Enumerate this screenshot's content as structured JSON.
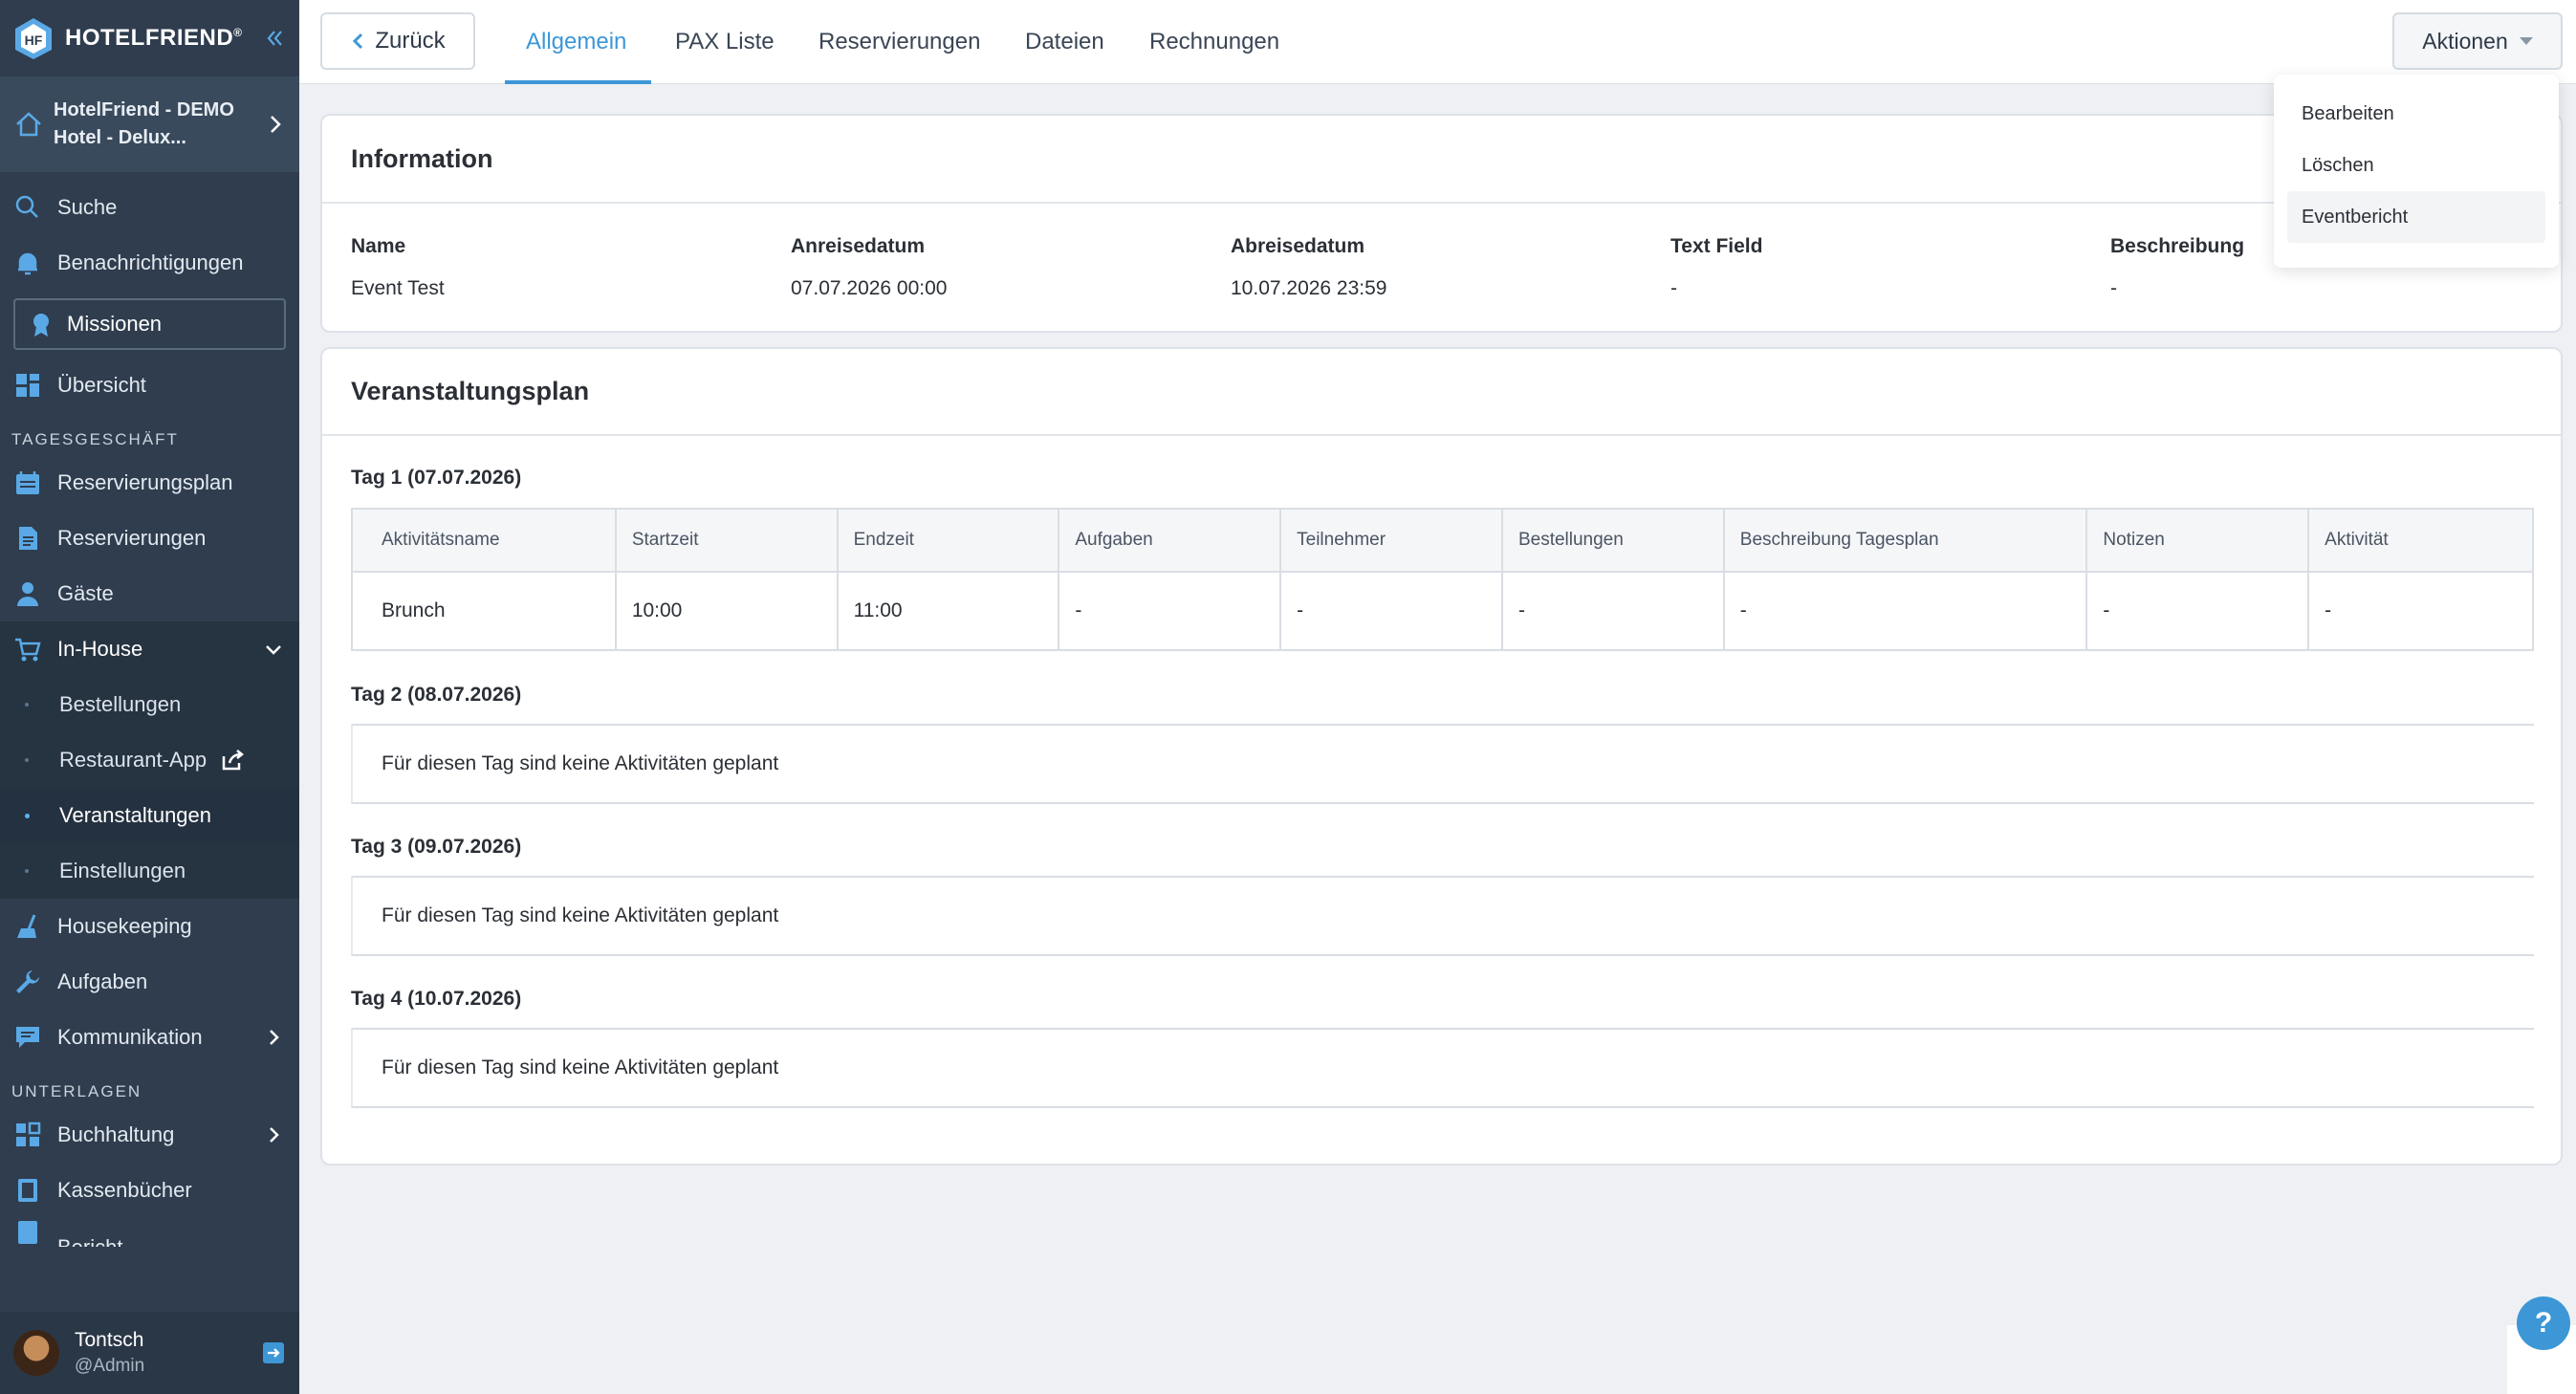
{
  "brand": {
    "name": "HOTELFRIEND",
    "mark": "®"
  },
  "hotel": {
    "name": "HotelFriend - DEMO Hotel - Delux..."
  },
  "sidebar": {
    "search": "Suche",
    "notifications": "Benachrichtigungen",
    "missions": "Missionen",
    "overview": "Übersicht",
    "section_daily": "TAGESGESCHÄFT",
    "reservation_plan": "Reservierungsplan",
    "reservations": "Reservierungen",
    "guests": "Gäste",
    "inhouse": "In-House",
    "inhouse_items": [
      "Bestellungen",
      "Restaurant-App",
      "Veranstaltungen",
      "Einstellungen"
    ],
    "housekeeping": "Housekeeping",
    "tasks": "Aufgaben",
    "communication": "Kommunikation",
    "section_docs": "UNTERLAGEN",
    "accounting": "Buchhaltung",
    "cashbooks": "Kassenbücher",
    "cut_item": "Bericht"
  },
  "user": {
    "name": "Tontsch",
    "handle": "@Admin"
  },
  "topbar": {
    "back": "Zurück",
    "tabs": [
      "Allgemein",
      "PAX Liste",
      "Reservierungen",
      "Dateien",
      "Rechnungen"
    ],
    "actions": "Aktionen"
  },
  "dropdown": {
    "items": [
      "Bearbeiten",
      "Löschen",
      "Eventbericht"
    ]
  },
  "information": {
    "title": "Information",
    "fields": [
      {
        "label": "Name",
        "value": "Event Test"
      },
      {
        "label": "Anreisedatum",
        "value": "07.07.2026 00:00"
      },
      {
        "label": "Abreisedatum",
        "value": "10.07.2026 23:59"
      },
      {
        "label": "Text Field",
        "value": "-"
      },
      {
        "label": "Beschreibung",
        "value": "-"
      }
    ]
  },
  "schedule": {
    "title": "Veranstaltungsplan",
    "day1": "Tag 1 (07.07.2026)",
    "columns": [
      "Aktivitätsname",
      "Startzeit",
      "Endzeit",
      "Aufgaben",
      "Teilnehmer",
      "Bestellungen",
      "Beschreibung Tagesplan",
      "Notizen",
      "Aktivität"
    ],
    "rows": [
      [
        "Brunch",
        "10:00",
        "11:00",
        "-",
        "-",
        "-",
        "-",
        "-",
        "-"
      ]
    ],
    "day2": "Tag 2 (08.07.2026)",
    "day3": "Tag 3 (09.07.2026)",
    "day4": "Tag 4 (10.07.2026)",
    "empty": "Für diesen Tag sind keine Aktivitäten geplant"
  },
  "help": "?"
}
